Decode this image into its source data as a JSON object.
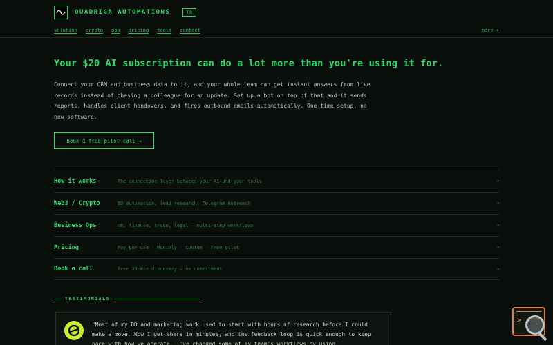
{
  "header": {
    "brand": "QUADRIGA AUTOMATIONS",
    "lang_badge": "TR",
    "logo_icon": "wave-logo-icon"
  },
  "nav": {
    "items": [
      "solution",
      "crypto",
      "ops",
      "pricing",
      "tools",
      "contact"
    ],
    "more": "more ▾"
  },
  "hero": {
    "title": "Your $20 AI subscription can do a lot more than you're using it for.",
    "text": "Connect your CRM and business data to it, and your whole team can get instant answers from live records instead of chasing a colleague for an update. Set up a bot on top of that and it sends reports, handles client handovers, and fires outbound emails automatically. One-time setup, no new software.",
    "cta": "Book a free pilot call →"
  },
  "accordion": [
    {
      "title": "How it works",
      "desc": "The connection layer between your AI and your tools",
      "icon": "+"
    },
    {
      "title": "Web3 / Crypto",
      "desc": "BD automation, lead research, Telegram outreach",
      "icon": "+"
    },
    {
      "title": "Business Ops",
      "desc": "HR, finance, trade, legal — multi-step workflows",
      "icon": "+"
    },
    {
      "title": "Pricing",
      "desc": "Pay per use · Monthly · Custom · Free pilot",
      "icon": "+"
    },
    {
      "title": "Book a call",
      "desc": "Free 30-min discovery — no commitment",
      "icon": "+"
    }
  ],
  "testimonials": {
    "label": "TESTIMONIALS",
    "quote": "\"Most of my BD and marketing work used to start with hours of research before I could make a move. Now I get there in minutes, and the feedback loop is quick enough to keep pace with how we operate. I've changed some of my team's workflows by using"
  },
  "colors": {
    "accent": "#2bd96b",
    "background": "#0b0f0c",
    "muted_accent": "#2f7a48",
    "widget": "#e0793b"
  }
}
